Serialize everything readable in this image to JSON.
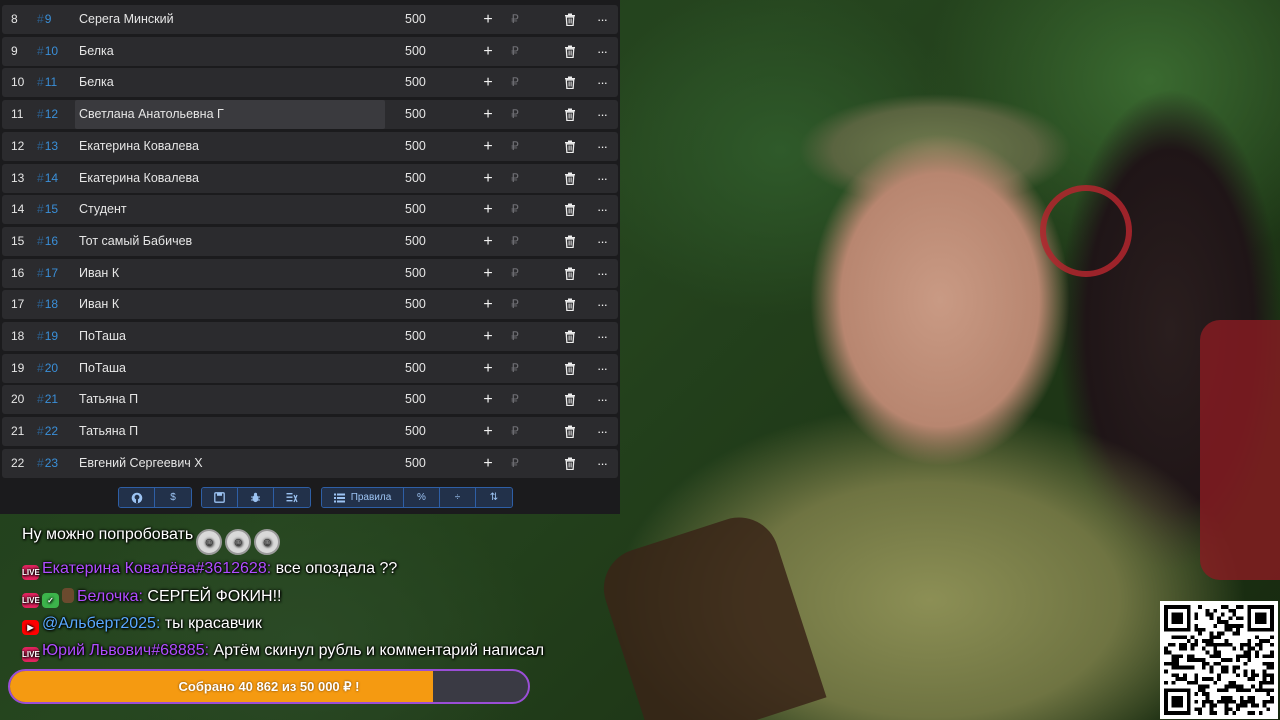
{
  "table": {
    "rows": [
      {
        "n": "8",
        "id": "9",
        "name": "Серега Минский",
        "amount": "500"
      },
      {
        "n": "9",
        "id": "10",
        "name": "Белка",
        "amount": "500"
      },
      {
        "n": "10",
        "id": "11",
        "name": "Белка",
        "amount": "500"
      },
      {
        "n": "11",
        "id": "12",
        "name": "Светлана Анатольевна Г",
        "amount": "500"
      },
      {
        "n": "12",
        "id": "13",
        "name": "Екатерина Ковалева",
        "amount": "500"
      },
      {
        "n": "13",
        "id": "14",
        "name": "Екатерина Ковалева",
        "amount": "500"
      },
      {
        "n": "14",
        "id": "15",
        "name": "Студент",
        "amount": "500"
      },
      {
        "n": "15",
        "id": "16",
        "name": "Тот самый Бабичев",
        "amount": "500"
      },
      {
        "n": "16",
        "id": "17",
        "name": "Иван К",
        "amount": "500"
      },
      {
        "n": "17",
        "id": "18",
        "name": "Иван К",
        "amount": "500"
      },
      {
        "n": "18",
        "id": "19",
        "name": "ПоТаша",
        "amount": "500"
      },
      {
        "n": "19",
        "id": "20",
        "name": "ПоТаша",
        "amount": "500"
      },
      {
        "n": "20",
        "id": "21",
        "name": "Татьяна П",
        "amount": "500"
      },
      {
        "n": "21",
        "id": "22",
        "name": "Татьяна П",
        "amount": "500"
      },
      {
        "n": "22",
        "id": "23",
        "name": "Евгений Сергеевич Х",
        "amount": "500"
      }
    ],
    "active_row": 3,
    "id_prefix": "#",
    "plus_glyph": "+",
    "currency_glyph": "₽",
    "more_glyph": "···"
  },
  "toolbar": {
    "groups": [
      {
        "buttons": [
          {
            "icon": "github-icon"
          },
          {
            "label": "$"
          }
        ]
      },
      {
        "buttons": [
          {
            "icon": "save-icon"
          },
          {
            "icon": "bug-icon"
          },
          {
            "icon": "clear-list-icon"
          }
        ]
      },
      {
        "buttons": [
          {
            "label": "Правила",
            "icon": "list-icon"
          },
          {
            "label": "%"
          },
          {
            "label": "÷"
          },
          {
            "label": "⇅"
          }
        ]
      }
    ]
  },
  "chat": {
    "messages": [
      {
        "badges": [],
        "nick": "",
        "text": "Ну можно попробовать",
        "emotes": 3
      },
      {
        "badges": [
          "live"
        ],
        "nick": "Екатерина Ковалёва#3612628:",
        "text": "все опоздала ??"
      },
      {
        "badges": [
          "live",
          "check",
          "avatar"
        ],
        "nick": "Белочка:",
        "text": "СЕРГЕЙ ФОКИН!!"
      },
      {
        "badges": [
          "yt"
        ],
        "nick": "@Альберт2025:",
        "text": "ты красавчик",
        "platform": "youtube"
      },
      {
        "badges": [
          "live"
        ],
        "nick": "Юрий Львович#68885:",
        "text": "Артём скинул рубль и комментарий написал"
      }
    ]
  },
  "goal": {
    "text": "Собрано 40 862  из 50 000 ₽ !",
    "collected": 40862,
    "target": 50000,
    "fill_color": "#f59a11",
    "border_color": "#9a4ed6"
  },
  "colors": {
    "accent": "#3a8fd8",
    "live": "#e0245e",
    "twitch_nick": "#b04dff",
    "youtube_nick": "#5aa9ff"
  }
}
